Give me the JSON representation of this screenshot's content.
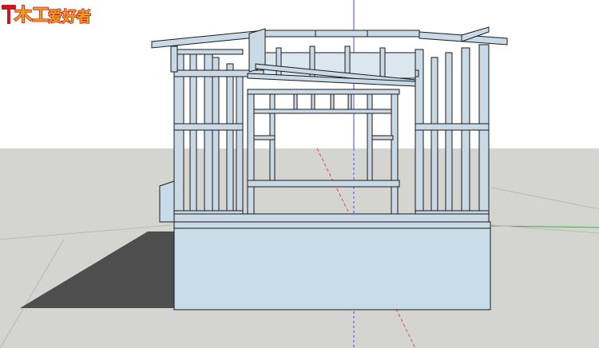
{
  "scene": {
    "sky_color": "#ffffff",
    "ground_color": "#d4d4d0",
    "shadow_color": "#4e4e4e",
    "frame_face_color": "#c9dae6",
    "frame_edge_color": "#1a1a1a",
    "foundation_color": "#c8dce8",
    "axis_blue": "#4a4ad8",
    "axis_red": "#d84a4a",
    "axis_green": "#4aaa4a"
  },
  "logo": {
    "glyph_main": "木工",
    "glyph_sub": "爱好者",
    "text_color": "#f0a020",
    "outline_color": "#c8181e"
  }
}
